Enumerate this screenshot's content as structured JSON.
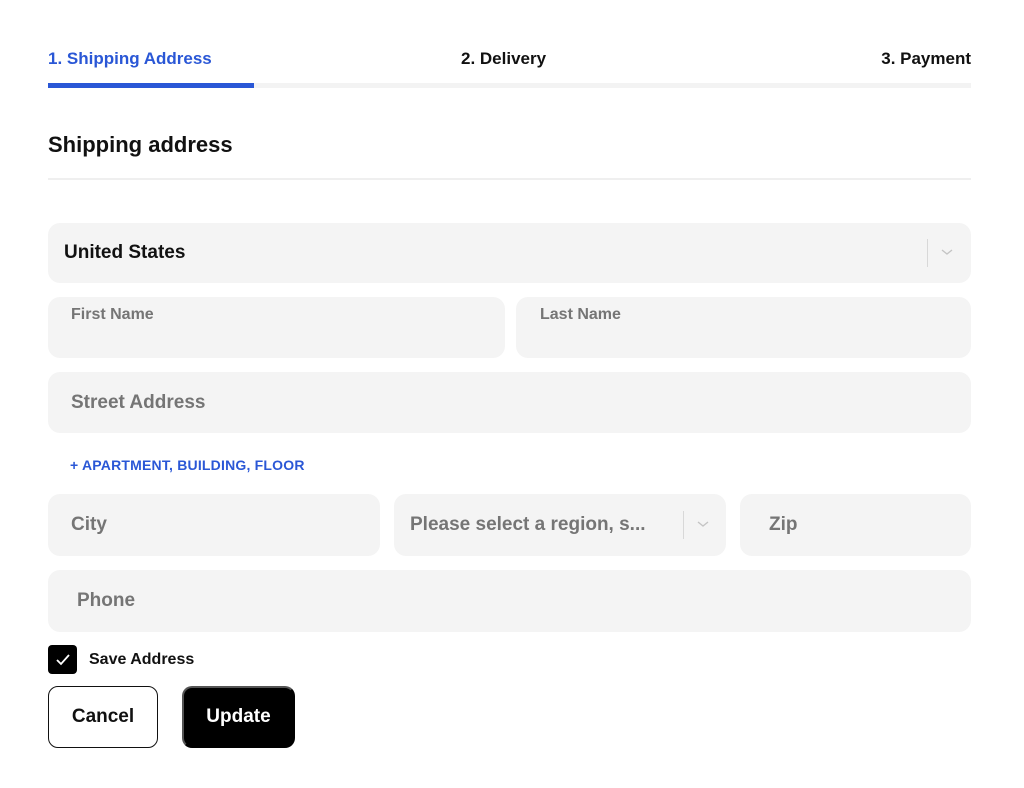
{
  "stepper": {
    "steps": [
      {
        "label": "1. Shipping Address",
        "active": true
      },
      {
        "label": "2. Delivery",
        "active": false
      },
      {
        "label": "3. Payment",
        "active": false
      }
    ],
    "progress_fraction": 0.2233,
    "accent_color": "#2a57d6"
  },
  "section": {
    "title": "Shipping address"
  },
  "form": {
    "country": {
      "value": "United States",
      "icon": "chevron-down-icon"
    },
    "first_name": {
      "label": "First Name",
      "value": ""
    },
    "last_name": {
      "label": "Last Name",
      "value": ""
    },
    "street": {
      "placeholder": "Street Address",
      "value": ""
    },
    "apartment_link": "+ APARTMENT, BUILDING, FLOOR",
    "city": {
      "placeholder": "City",
      "value": ""
    },
    "region": {
      "placeholder": "Please select a region, s...",
      "icon": "chevron-down-icon"
    },
    "zip": {
      "placeholder": "Zip",
      "value": ""
    },
    "phone": {
      "placeholder": "Phone",
      "value": ""
    },
    "save_address": {
      "label": "Save Address",
      "checked": true
    }
  },
  "actions": {
    "cancel_label": "Cancel",
    "update_label": "Update"
  }
}
